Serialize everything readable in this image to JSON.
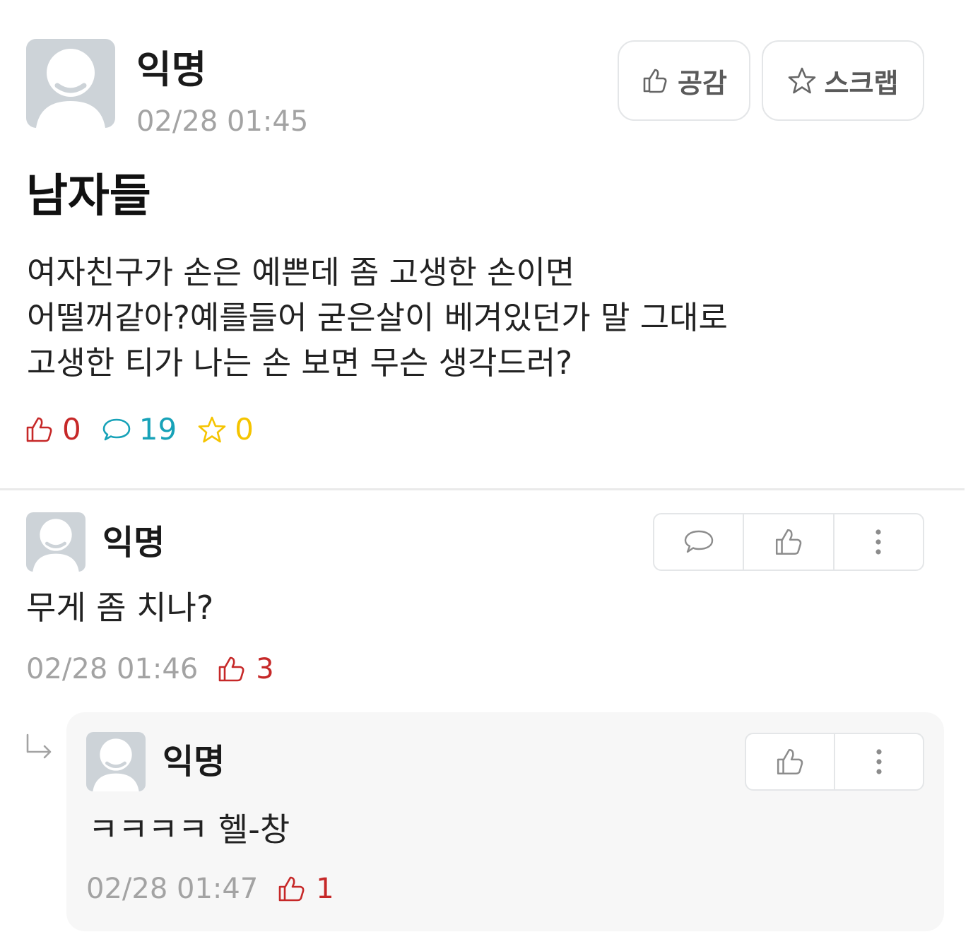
{
  "post": {
    "author": "익명",
    "timestamp": "02/28 01:45",
    "like_button_label": "공감",
    "scrap_button_label": "스크랩",
    "title": "남자들",
    "body_lines": [
      "여자친구가 손은 예쁜데 좀 고생한 손이면",
      "어떨꺼같아?예를들어 굳은살이 베겨있던가 말 그대로",
      "고생한 티가 나는 손 보면 무슨 생각드러?"
    ],
    "stats": {
      "likes": "0",
      "comments": "19",
      "scraps": "0"
    }
  },
  "comments": [
    {
      "author": "익명",
      "text": "무게 좀 치나?",
      "timestamp": "02/28 01:46",
      "likes": "3",
      "icons": [
        "comment-icon",
        "thumbs-up-icon",
        "more-vertical-icon"
      ]
    },
    {
      "author": "익명",
      "text": "ㅋㅋㅋㅋ 헬-창",
      "timestamp": "02/28 01:47",
      "likes": "1",
      "is_reply": true,
      "icons": [
        "thumbs-up-icon",
        "more-vertical-icon"
      ]
    }
  ],
  "colors": {
    "like": "#c62828",
    "comment": "#17a2b8",
    "scrap": "#f5c400",
    "meta_gray": "#a3a3a3",
    "avatar_bg": "#cdd3d8",
    "reply_bg": "#f7f7f7"
  }
}
